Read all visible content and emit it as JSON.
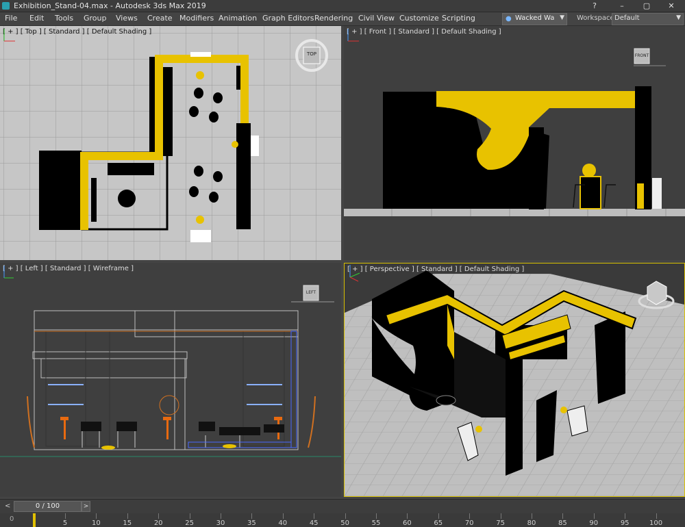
{
  "app": {
    "title": "Exhibition_Stand-04.max - Autodesk 3ds Max 2019"
  },
  "window_controls": [
    "?",
    "–",
    "▢",
    "✕"
  ],
  "menus": [
    "File",
    "Edit",
    "Tools",
    "Group",
    "Views",
    "Create",
    "Modifiers",
    "Animation",
    "Graph Editors",
    "Rendering",
    "Civil View",
    "Customize",
    "Scripting"
  ],
  "user": {
    "name": "Wacked Wa"
  },
  "workspaces": {
    "label": "Workspaces:",
    "value": "Default"
  },
  "viewports": {
    "top": {
      "label": "[ + ] [ Top ] [ Standard ] [ Default Shading ]",
      "cube": "TOP"
    },
    "front": {
      "label": "[ + ] [ Front ] [ Standard ] [ Default Shading ]",
      "cube": "FRONT"
    },
    "left": {
      "label": "[ + ] [ Left ] [ Standard ] [ Wireframe ]",
      "cube": "LEFT"
    },
    "perspective": {
      "label": "[ + ] [ Perspective ] [ Standard ] [ Default Shading ]"
    }
  },
  "timeline": {
    "frame": "0 / 100",
    "lead": "0",
    "ticks": [
      "5",
      "10",
      "15",
      "20",
      "25",
      "30",
      "35",
      "40",
      "45",
      "50",
      "55",
      "60",
      "65",
      "70",
      "75",
      "80",
      "85",
      "90",
      "95",
      "100"
    ]
  },
  "colors": {
    "accent_yellow": "#e8c200",
    "viewport_light": "#c8c8c8",
    "viewport_dark": "#3e3e3e",
    "active_border": "#d8c000"
  }
}
